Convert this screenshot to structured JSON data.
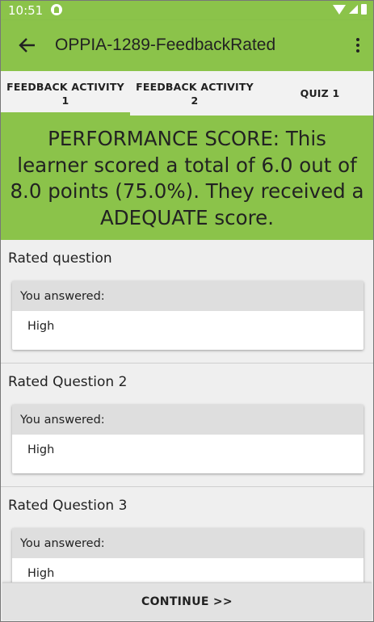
{
  "status_bar": {
    "time": "10:51"
  },
  "app_bar": {
    "title": "OPPIA-1289-FeedbackRated"
  },
  "tabs": [
    {
      "label_line1": "FEEDBACK ACTIVITY",
      "label_line2": "1",
      "active": true
    },
    {
      "label_line1": "FEEDBACK ACTIVITY",
      "label_line2": "2",
      "active": false
    },
    {
      "label_line1": "QUIZ 1",
      "label_line2": "",
      "active": false
    }
  ],
  "score": {
    "line1": "PERFORMANCE SCORE:  This",
    "line2": "learner scored a total of 6.0 out of",
    "line3": "8.0 points (75.0%). They received a",
    "line4": "ADEQUATE score."
  },
  "questions": [
    {
      "title": "Rated question",
      "answer_label": "You answered:",
      "answer": "High"
    },
    {
      "title": "Rated Question 2",
      "answer_label": "You answered:",
      "answer": "High"
    },
    {
      "title": "Rated Question 3",
      "answer_label": "You answered:",
      "answer": "High"
    }
  ],
  "continue_label": "CONTINUE >>",
  "colors": {
    "accent": "#8bc34a",
    "card_header": "#dedede",
    "background": "#efefef"
  }
}
